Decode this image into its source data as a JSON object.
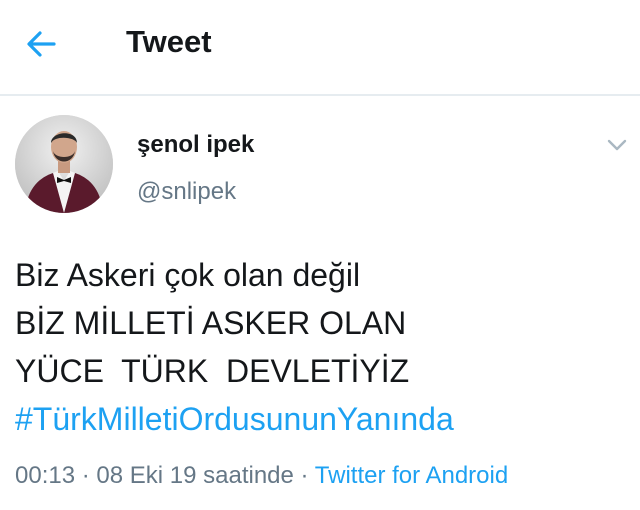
{
  "header": {
    "back_icon": "arrow-left-icon",
    "title": "Tweet",
    "accent_color": "#1da1f2"
  },
  "tweet": {
    "author_name": "şenol ipek",
    "author_handle": "@snlipek",
    "lines": [
      "Biz Askeri çok olan değil",
      "BİZ MİLLETİ ASKER OLAN",
      "YÜCE  TÜRK  DEVLETİYİZ"
    ],
    "hashtag": "#TürkMilletiOrdusununYanında",
    "time": "00:13",
    "date": "08 Eki 19 saatinde",
    "source": "Twitter for Android",
    "separator": " · ",
    "menu_icon": "chevron-down-icon"
  }
}
